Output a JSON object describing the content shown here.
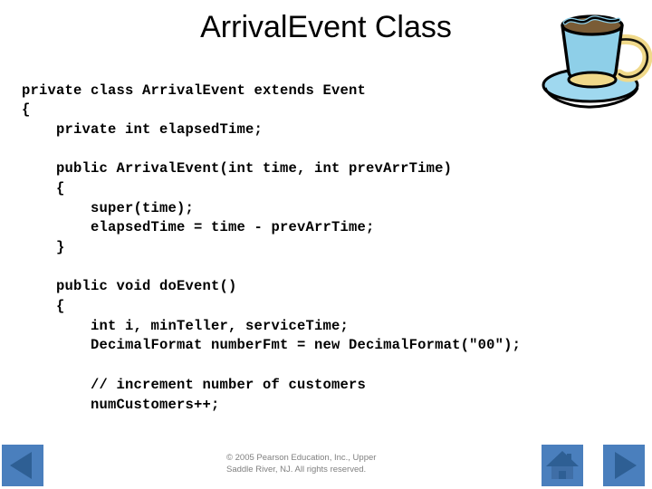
{
  "slide": {
    "title": "ArrivalEvent Class",
    "background_color": "#ffffff",
    "title_color": "#000000"
  },
  "artwork": {
    "coffee_cup": {
      "icon": "coffee-cup-icon",
      "cup_color": "#8ecfe8",
      "handle_color": "#f5e09a",
      "coffee_color": "#7a5c36",
      "outline_color": "#000000",
      "saucer_color": "#9fd8ef"
    }
  },
  "code": {
    "language": "java",
    "lines": [
      "private class ArrivalEvent extends Event",
      "{",
      "    private int elapsedTime;",
      "",
      "    public ArrivalEvent(int time, int prevArrTime)",
      "    {",
      "        super(time);",
      "        elapsedTime = time - prevArrTime;",
      "    }",
      "",
      "    public void doEvent()",
      "    {",
      "        int i, minTeller, serviceTime;",
      "        DecimalFormat numberFmt = new DecimalFormat(\"00\");",
      "",
      "        // increment number of customers",
      "        numCustomers++;"
    ]
  },
  "footer": {
    "copyright_line_1": "© 2005 Pearson Education, Inc., Upper",
    "copyright_line_2": "Saddle River, NJ.  All rights reserved.",
    "text_color": "#808080"
  },
  "navigation": {
    "button_color": "#4a7fbd",
    "glyph_color": "#2e5f94",
    "back": {
      "label": "Previous slide",
      "icon": "triangle-left-icon"
    },
    "home": {
      "label": "Home",
      "icon": "home-icon"
    },
    "next": {
      "label": "Next slide",
      "icon": "triangle-right-icon"
    }
  }
}
